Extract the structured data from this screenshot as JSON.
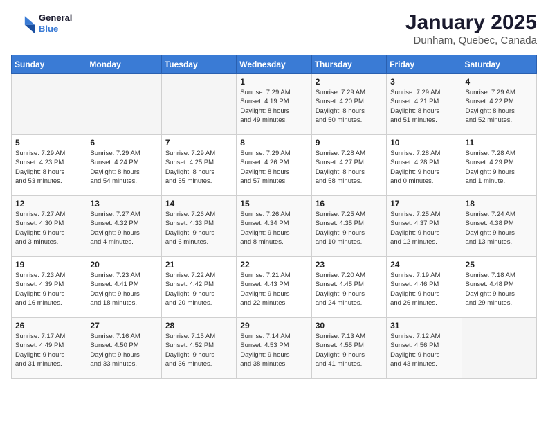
{
  "app": {
    "name": "GeneralBlue",
    "name_line1": "General",
    "name_line2": "Blue"
  },
  "title": "January 2025",
  "subtitle": "Dunham, Quebec, Canada",
  "weekdays": [
    "Sunday",
    "Monday",
    "Tuesday",
    "Wednesday",
    "Thursday",
    "Friday",
    "Saturday"
  ],
  "weeks": [
    [
      {
        "day": "",
        "info": ""
      },
      {
        "day": "",
        "info": ""
      },
      {
        "day": "",
        "info": ""
      },
      {
        "day": "1",
        "info": "Sunrise: 7:29 AM\nSunset: 4:19 PM\nDaylight: 8 hours\nand 49 minutes."
      },
      {
        "day": "2",
        "info": "Sunrise: 7:29 AM\nSunset: 4:20 PM\nDaylight: 8 hours\nand 50 minutes."
      },
      {
        "day": "3",
        "info": "Sunrise: 7:29 AM\nSunset: 4:21 PM\nDaylight: 8 hours\nand 51 minutes."
      },
      {
        "day": "4",
        "info": "Sunrise: 7:29 AM\nSunset: 4:22 PM\nDaylight: 8 hours\nand 52 minutes."
      }
    ],
    [
      {
        "day": "5",
        "info": "Sunrise: 7:29 AM\nSunset: 4:23 PM\nDaylight: 8 hours\nand 53 minutes."
      },
      {
        "day": "6",
        "info": "Sunrise: 7:29 AM\nSunset: 4:24 PM\nDaylight: 8 hours\nand 54 minutes."
      },
      {
        "day": "7",
        "info": "Sunrise: 7:29 AM\nSunset: 4:25 PM\nDaylight: 8 hours\nand 55 minutes."
      },
      {
        "day": "8",
        "info": "Sunrise: 7:29 AM\nSunset: 4:26 PM\nDaylight: 8 hours\nand 57 minutes."
      },
      {
        "day": "9",
        "info": "Sunrise: 7:28 AM\nSunset: 4:27 PM\nDaylight: 8 hours\nand 58 minutes."
      },
      {
        "day": "10",
        "info": "Sunrise: 7:28 AM\nSunset: 4:28 PM\nDaylight: 9 hours\nand 0 minutes."
      },
      {
        "day": "11",
        "info": "Sunrise: 7:28 AM\nSunset: 4:29 PM\nDaylight: 9 hours\nand 1 minute."
      }
    ],
    [
      {
        "day": "12",
        "info": "Sunrise: 7:27 AM\nSunset: 4:30 PM\nDaylight: 9 hours\nand 3 minutes."
      },
      {
        "day": "13",
        "info": "Sunrise: 7:27 AM\nSunset: 4:32 PM\nDaylight: 9 hours\nand 4 minutes."
      },
      {
        "day": "14",
        "info": "Sunrise: 7:26 AM\nSunset: 4:33 PM\nDaylight: 9 hours\nand 6 minutes."
      },
      {
        "day": "15",
        "info": "Sunrise: 7:26 AM\nSunset: 4:34 PM\nDaylight: 9 hours\nand 8 minutes."
      },
      {
        "day": "16",
        "info": "Sunrise: 7:25 AM\nSunset: 4:35 PM\nDaylight: 9 hours\nand 10 minutes."
      },
      {
        "day": "17",
        "info": "Sunrise: 7:25 AM\nSunset: 4:37 PM\nDaylight: 9 hours\nand 12 minutes."
      },
      {
        "day": "18",
        "info": "Sunrise: 7:24 AM\nSunset: 4:38 PM\nDaylight: 9 hours\nand 13 minutes."
      }
    ],
    [
      {
        "day": "19",
        "info": "Sunrise: 7:23 AM\nSunset: 4:39 PM\nDaylight: 9 hours\nand 16 minutes."
      },
      {
        "day": "20",
        "info": "Sunrise: 7:23 AM\nSunset: 4:41 PM\nDaylight: 9 hours\nand 18 minutes."
      },
      {
        "day": "21",
        "info": "Sunrise: 7:22 AM\nSunset: 4:42 PM\nDaylight: 9 hours\nand 20 minutes."
      },
      {
        "day": "22",
        "info": "Sunrise: 7:21 AM\nSunset: 4:43 PM\nDaylight: 9 hours\nand 22 minutes."
      },
      {
        "day": "23",
        "info": "Sunrise: 7:20 AM\nSunset: 4:45 PM\nDaylight: 9 hours\nand 24 minutes."
      },
      {
        "day": "24",
        "info": "Sunrise: 7:19 AM\nSunset: 4:46 PM\nDaylight: 9 hours\nand 26 minutes."
      },
      {
        "day": "25",
        "info": "Sunrise: 7:18 AM\nSunset: 4:48 PM\nDaylight: 9 hours\nand 29 minutes."
      }
    ],
    [
      {
        "day": "26",
        "info": "Sunrise: 7:17 AM\nSunset: 4:49 PM\nDaylight: 9 hours\nand 31 minutes."
      },
      {
        "day": "27",
        "info": "Sunrise: 7:16 AM\nSunset: 4:50 PM\nDaylight: 9 hours\nand 33 minutes."
      },
      {
        "day": "28",
        "info": "Sunrise: 7:15 AM\nSunset: 4:52 PM\nDaylight: 9 hours\nand 36 minutes."
      },
      {
        "day": "29",
        "info": "Sunrise: 7:14 AM\nSunset: 4:53 PM\nDaylight: 9 hours\nand 38 minutes."
      },
      {
        "day": "30",
        "info": "Sunrise: 7:13 AM\nSunset: 4:55 PM\nDaylight: 9 hours\nand 41 minutes."
      },
      {
        "day": "31",
        "info": "Sunrise: 7:12 AM\nSunset: 4:56 PM\nDaylight: 9 hours\nand 43 minutes."
      },
      {
        "day": "",
        "info": ""
      }
    ]
  ]
}
